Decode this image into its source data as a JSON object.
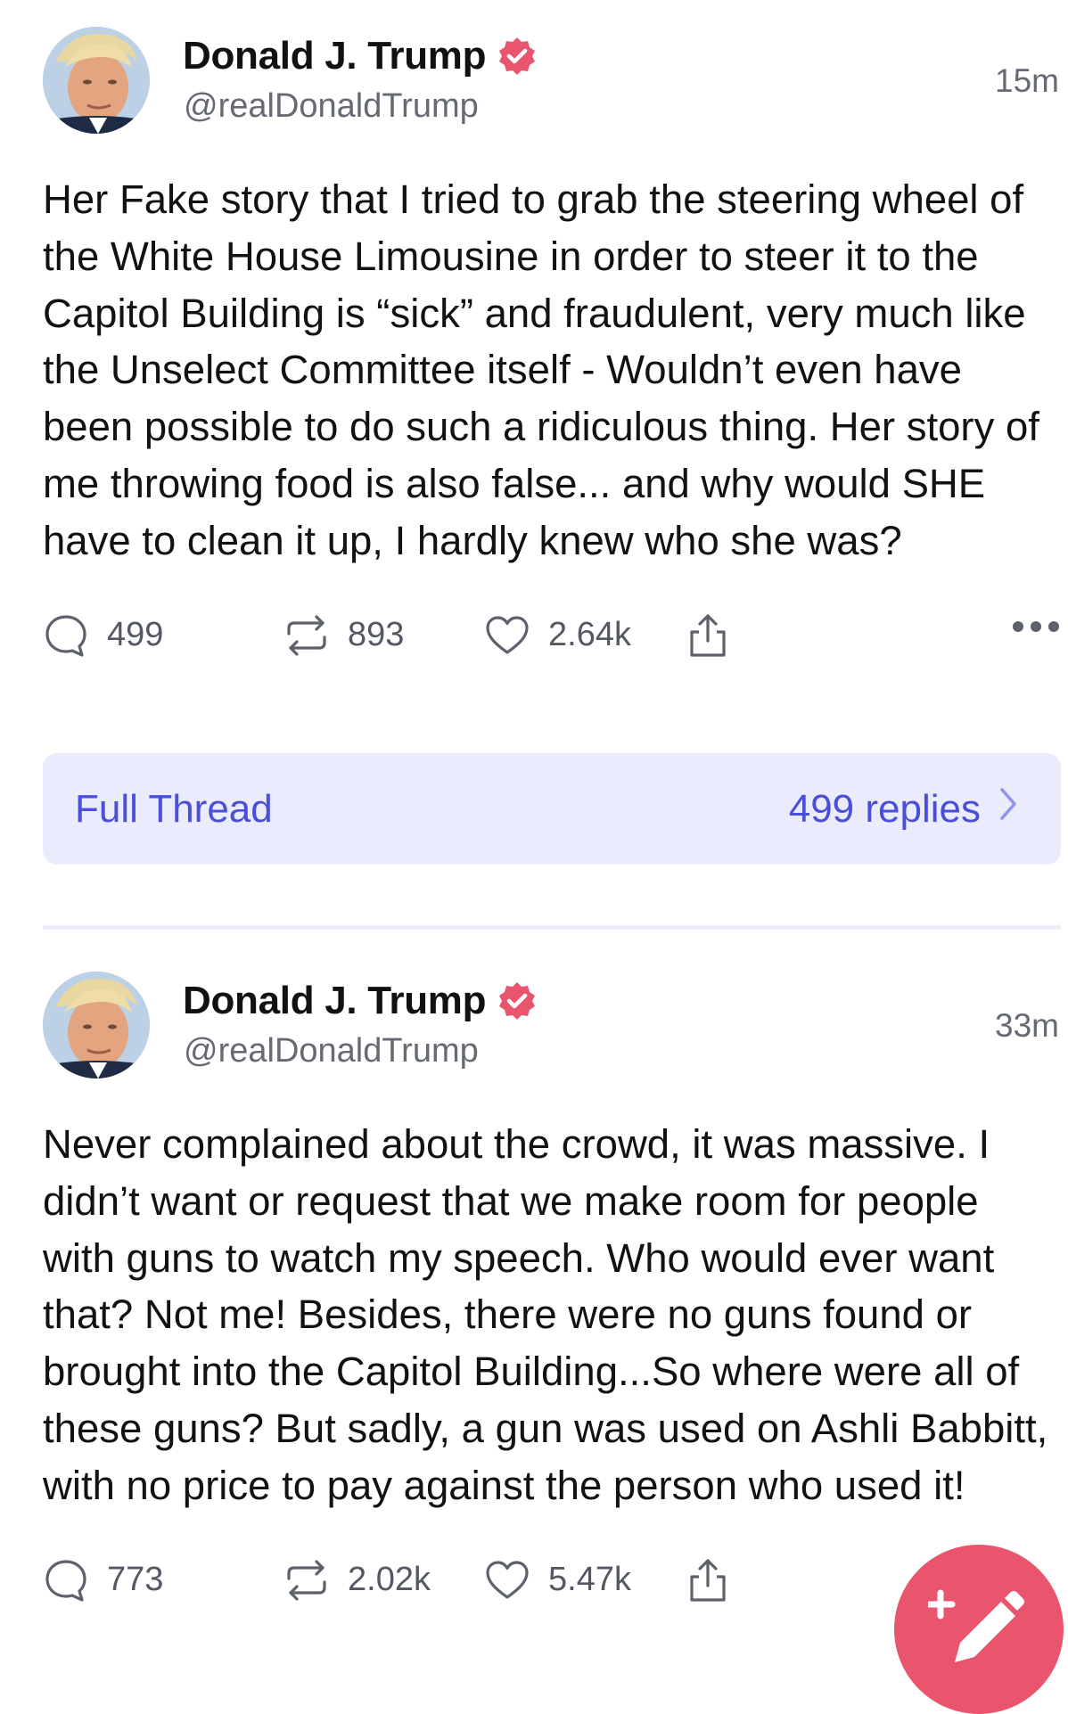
{
  "colors": {
    "accent": "#4a4fd8",
    "thread_bar_bg": "#eaebfd",
    "verified_badge": "#e8556d",
    "fab": "#e8556d",
    "muted_text": "#666a73"
  },
  "posts": [
    {
      "author": {
        "display_name": "Donald J. Trump",
        "handle": "@realDonaldTrump",
        "verified_icon": "verified-badge-icon"
      },
      "timestamp": "15m",
      "body": "Her Fake story that I tried to grab the steering wheel of the White House Limousine in order to steer it to the Capitol Building is “sick” and fraudulent, very much like the Unselect Committee itself - Wouldn’t even have been possible to do such a ridiculous thing. Her story of me throwing food is also false... and why would SHE have to clean it up, I hardly knew who she was?",
      "actions": {
        "replies": "499",
        "reposts": "893",
        "likes": "2.64k"
      }
    },
    {
      "author": {
        "display_name": "Donald J. Trump",
        "handle": "@realDonaldTrump",
        "verified_icon": "verified-badge-icon"
      },
      "timestamp": "33m",
      "body": "Never complained about the crowd, it was massive. I didn’t want or request that we make room for people with guns to watch my speech. Who would ever want that? Not me! Besides, there were no guns found or brought into the Capitol Building...So where were all of these guns? But sadly, a gun was used on Ashli Babbitt, with no price to pay against the person who used it!",
      "actions": {
        "replies": "773",
        "reposts": "2.02k",
        "likes": "5.47k"
      }
    }
  ],
  "thread_bar": {
    "label": "Full Thread",
    "replies_label": "499 replies"
  },
  "icons": {
    "reply": "reply-icon",
    "repost": "repost-icon",
    "like": "heart-icon",
    "share": "share-icon",
    "more": "more-icon",
    "compose": "compose-icon"
  }
}
